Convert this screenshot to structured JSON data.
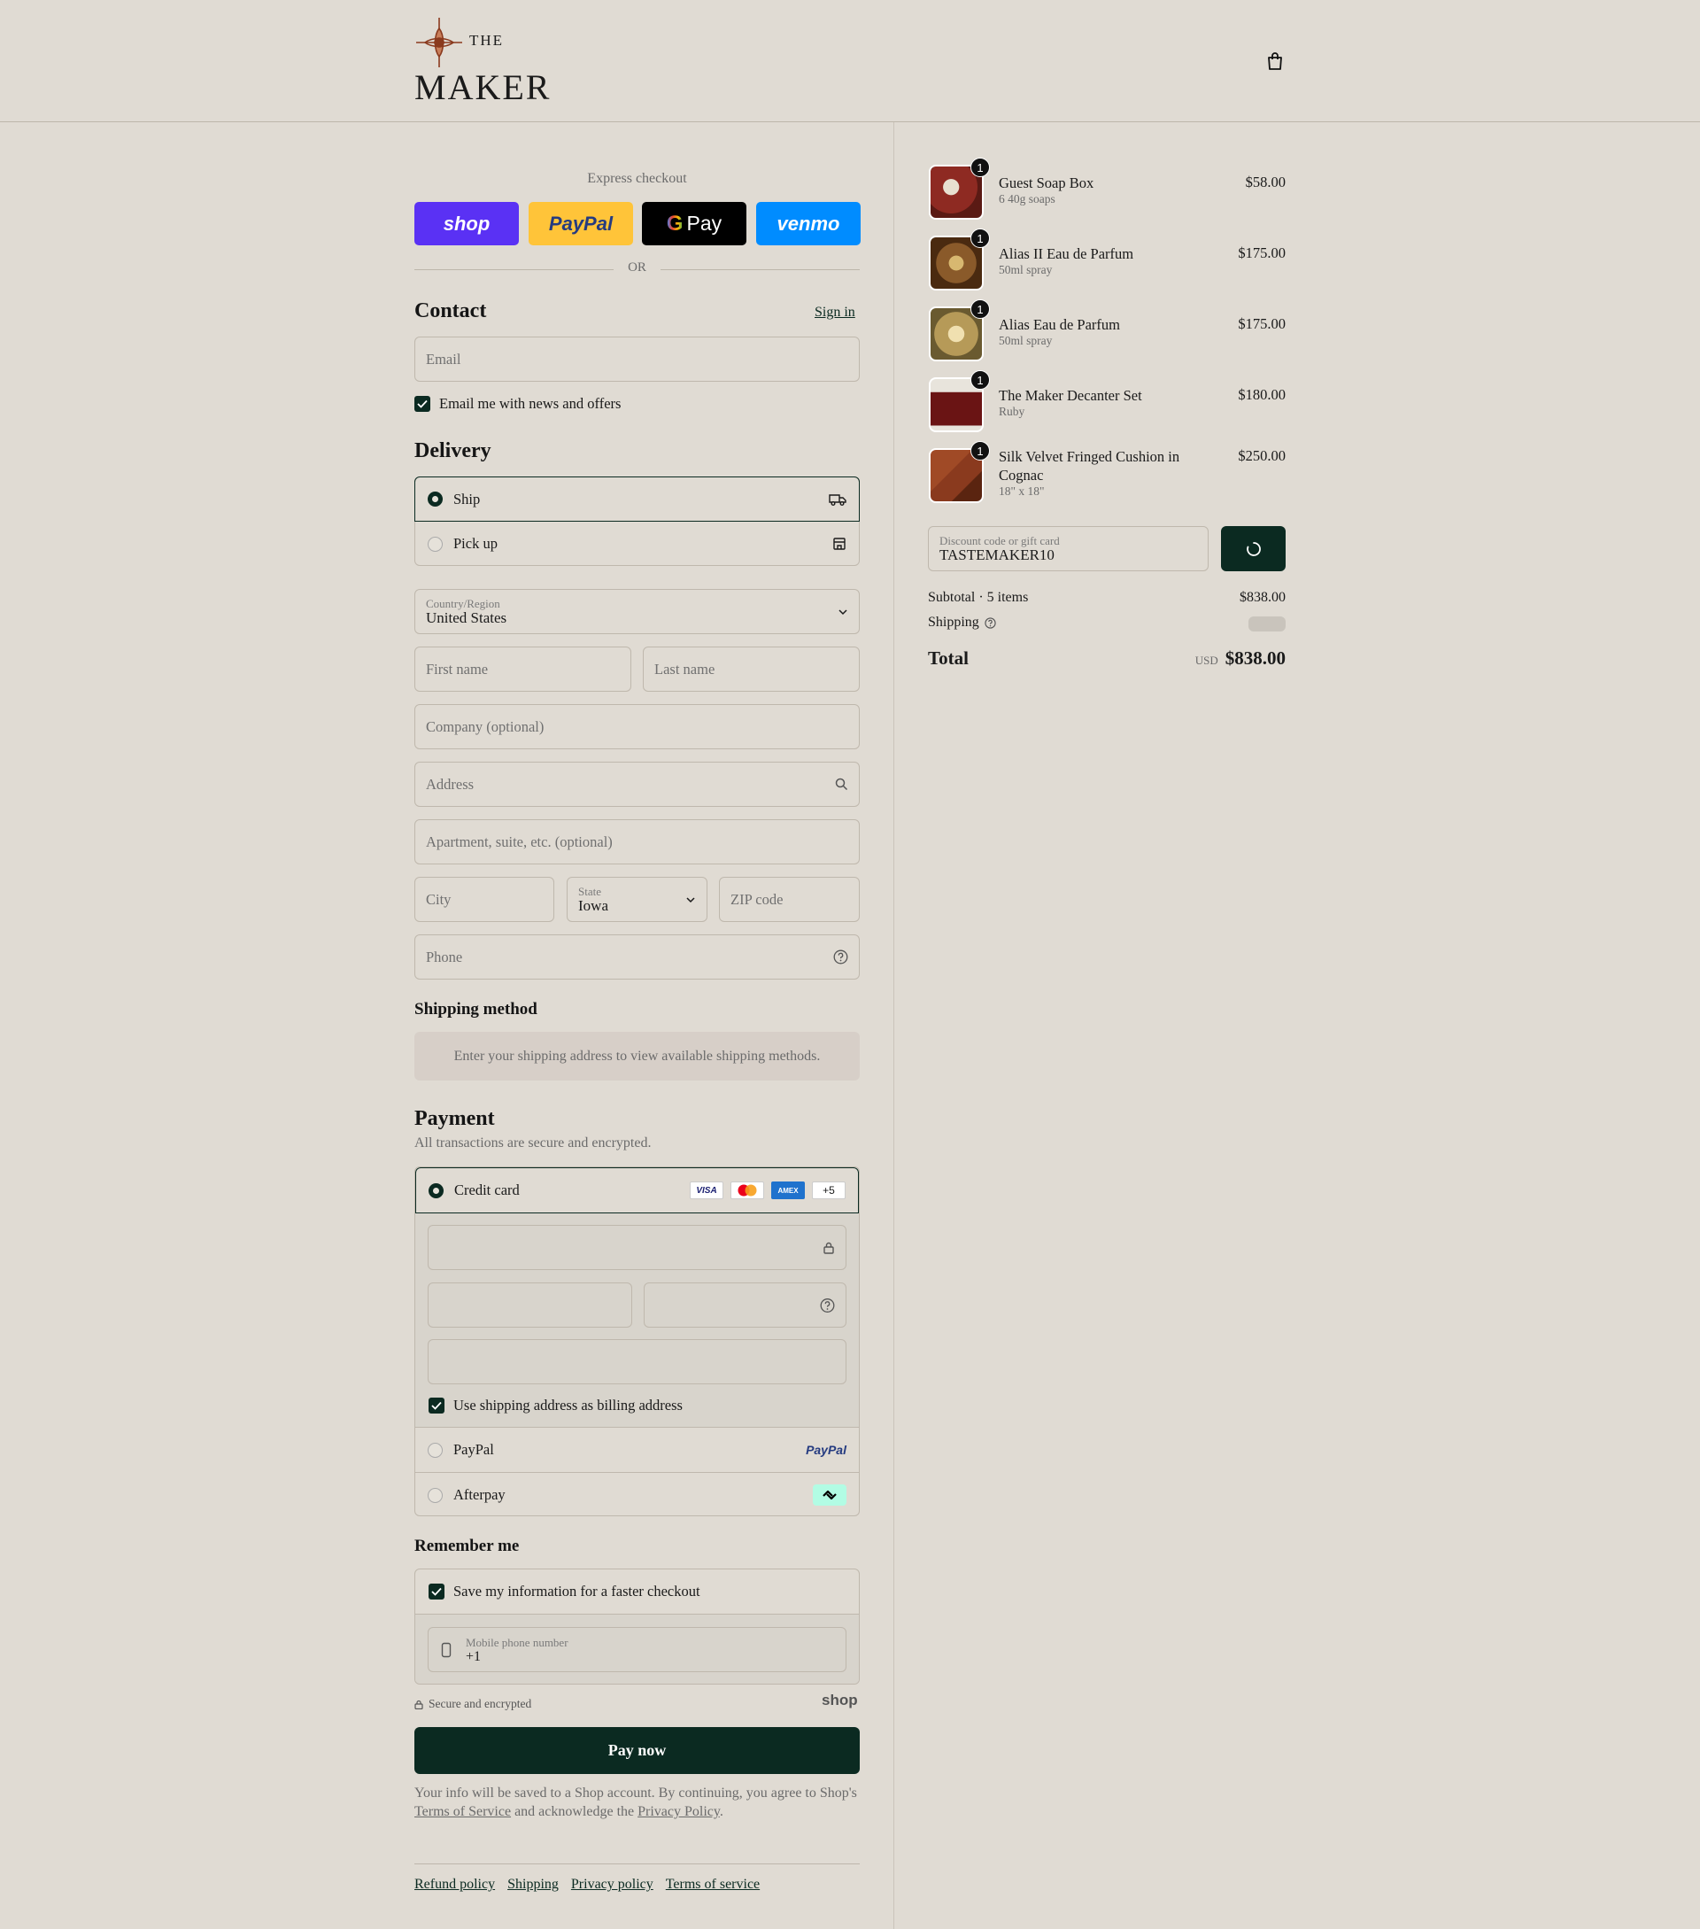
{
  "brand": {
    "top_word": "THE",
    "name": "MAKER"
  },
  "express": {
    "title": "Express checkout",
    "buttons": [
      {
        "label": "shop",
        "color": "#5a31f4"
      },
      {
        "label": "PayPal",
        "color": "#ffc439"
      },
      {
        "label": "Pay",
        "color": "#000000"
      },
      {
        "label": "venmo",
        "color": "#008cff"
      }
    ],
    "or": "OR"
  },
  "contact": {
    "title": "Contact",
    "sign_in": "Sign in",
    "email_placeholder": "Email",
    "news_label": "Email me with news and offers",
    "news_checked": true
  },
  "delivery": {
    "title": "Delivery",
    "options": [
      {
        "label": "Ship",
        "selected": true,
        "icon": "truck-icon"
      },
      {
        "label": "Pick up",
        "selected": false,
        "icon": "store-icon"
      }
    ],
    "country_label": "Country/Region",
    "country_value": "United States",
    "first_name": "First name",
    "last_name": "Last name",
    "company": "Company (optional)",
    "address": "Address",
    "apartment": "Apartment, suite, etc. (optional)",
    "city": "City",
    "state_label": "State",
    "state_value": "Iowa",
    "zip": "ZIP code",
    "phone": "Phone"
  },
  "shipping_method": {
    "title": "Shipping method",
    "notice": "Enter your shipping address to view available shipping methods."
  },
  "payment": {
    "title": "Payment",
    "subtitle": "All transactions are secure and encrypted.",
    "credit_card_label": "Credit card",
    "card_brands": [
      "VISA",
      "Mastercard",
      "AMEX",
      "+5"
    ],
    "billing_same_label": "Use shipping address as billing address",
    "billing_same_checked": true,
    "paypal_label": "PayPal",
    "paypal_logo": "PayPal",
    "afterpay_label": "Afterpay"
  },
  "remember": {
    "title": "Remember me",
    "save_label": "Save my information for a faster checkout",
    "save_checked": true,
    "mobile_label": "Mobile phone number",
    "mobile_value": "+1",
    "secure_text": "Secure and encrypted",
    "shop_logo": "shop"
  },
  "pay_now": "Pay now",
  "legal": {
    "text_before": "Your info will be saved to a Shop account. By continuing, you agree to Shop's ",
    "tos": "Terms of Service",
    "middle": " and acknowledge the ",
    "privacy": "Privacy Policy",
    "end": "."
  },
  "footer_links": [
    "Refund policy",
    "Shipping",
    "Privacy policy",
    "Terms of service"
  ],
  "cart": {
    "items": [
      {
        "name": "Guest Soap Box",
        "variant": "6 40g soaps",
        "price": "$58.00",
        "qty": "1",
        "color": "#8e2a22"
      },
      {
        "name": "Alias II Eau de Parfum",
        "variant": "50ml spray",
        "price": "$175.00",
        "qty": "1",
        "color": "#8a5a2a"
      },
      {
        "name": "Alias Eau de Parfum",
        "variant": "50ml spray",
        "price": "$175.00",
        "qty": "1",
        "color": "#b69a58"
      },
      {
        "name": "The Maker Decanter Set",
        "variant": "Ruby",
        "price": "$180.00",
        "qty": "1",
        "color": "#6a1414"
      },
      {
        "name": "Silk Velvet Fringed Cushion in Cognac",
        "variant": "18\" x 18\"",
        "price": "$250.00",
        "qty": "1",
        "color": "#8a3a1e"
      }
    ],
    "discount_label": "Discount code or gift card",
    "discount_value": "TASTEMAKER10",
    "subtotal_label": "Subtotal · 5 items",
    "subtotal_value": "$838.00",
    "shipping_label": "Shipping",
    "total_label": "Total",
    "currency": "USD",
    "total_value": "$838.00"
  },
  "colors": {
    "background": "#e0dbd3",
    "primary": "#0b2a21",
    "notice_bg": "#d7cfc8"
  }
}
